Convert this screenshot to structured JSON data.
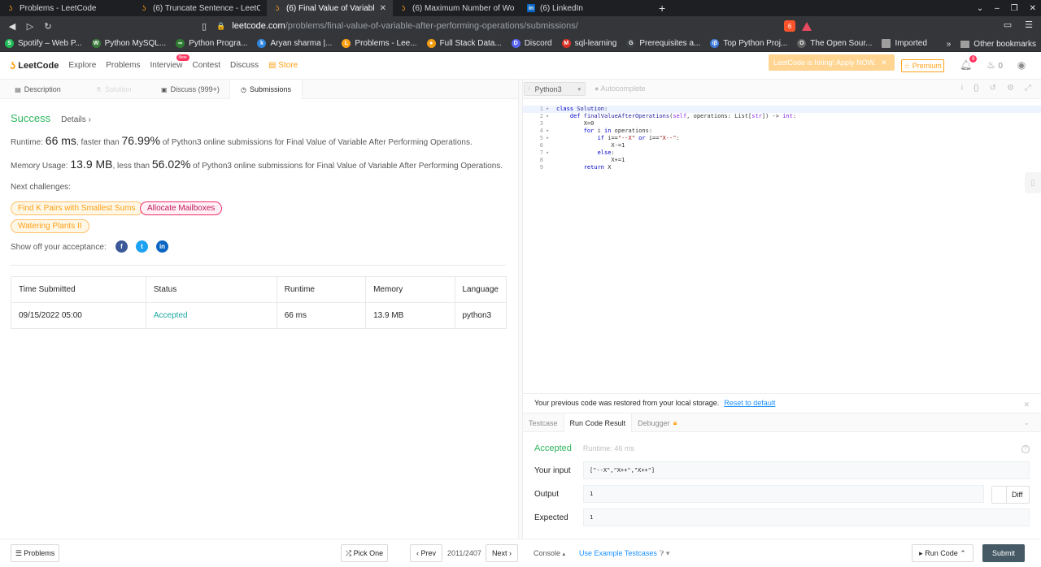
{
  "browser": {
    "tabs": [
      {
        "title": "Problems - LeetCode",
        "icon": "leetcode-icon"
      },
      {
        "title": "(6) Truncate Sentence - LeetCo",
        "icon": "leetcode-icon"
      },
      {
        "title": "(6) Final Value of Variable Af",
        "icon": "leetcode-icon"
      },
      {
        "title": "(6) Maximum Number of Words",
        "icon": "leetcode-icon"
      },
      {
        "title": "(6) LinkedIn",
        "icon": "linkedin-icon"
      }
    ],
    "url_host": "leetcode.com",
    "url_path": "/problems/final-value-of-variable-after-performing-operations/submissions/",
    "brave_badge": "6",
    "bookmarks": [
      {
        "label": "Spotify – Web P...",
        "color": "#1db954",
        "glyph": "S"
      },
      {
        "label": "Python MySQL...",
        "color": "#3a7a3a",
        "glyph": "W"
      },
      {
        "label": "Python Progra...",
        "color": "#2e7d32",
        "glyph": "∞"
      },
      {
        "label": "Aryan sharma |...",
        "color": "#2e86de",
        "glyph": "k"
      },
      {
        "label": "Problems - Lee...",
        "color": "#ffa116",
        "glyph": "L"
      },
      {
        "label": "Full Stack Data...",
        "color": "#f39c12",
        "glyph": "●"
      },
      {
        "label": "Discord",
        "color": "#5865f2",
        "glyph": "D"
      },
      {
        "label": "sql-learning",
        "color": "#d93025",
        "glyph": "M"
      },
      {
        "label": "Prerequisites a...",
        "color": "#3c4043",
        "glyph": "G"
      },
      {
        "label": "Top Python Proj...",
        "color": "#3c78d8",
        "glyph": "iβ"
      },
      {
        "label": "The Open Sour...",
        "color": "#616161",
        "glyph": "O"
      },
      {
        "label": "Imported",
        "color": "#9e9e9e",
        "glyph": "▬"
      }
    ],
    "bookmarks_more": "»",
    "other_bookmarks": "Other bookmarks"
  },
  "nav": {
    "logo": "LeetCode",
    "links": [
      "Explore",
      "Problems",
      "Interview",
      "Contest",
      "Discuss"
    ],
    "new_badge": "New",
    "store": "Store",
    "hiring_banner": "LeetCode is hiring! Apply NOW.",
    "premium": "Premium",
    "notification_count": "6",
    "streak_count": "0"
  },
  "left_tabs": [
    "Description",
    "Solution",
    "Discuss (999+)",
    "Submissions"
  ],
  "result": {
    "status": "Success",
    "details": "Details",
    "runtime_label": "Runtime:",
    "runtime_value": "66 ms",
    "runtime_mid": ", faster than",
    "runtime_pct": "76.99%",
    "runtime_tail": "of Python3 online submissions for Final Value of Variable After Performing Operations.",
    "memory_label": "Memory Usage:",
    "memory_value": "13.9 MB",
    "memory_mid": ", less than",
    "memory_pct": "56.02%",
    "memory_tail": "of Python3 online submissions for Final Value of Variable After Performing Operations.",
    "next_label": "Next challenges:",
    "challenges": [
      "Find K Pairs with Smallest Sums",
      "Allocate Mailboxes",
      "Watering Plants II"
    ],
    "share_label": "Show off your acceptance:"
  },
  "table": {
    "headers": [
      "Time Submitted",
      "Status",
      "Runtime",
      "Memory",
      "Language"
    ],
    "rows": [
      [
        "09/15/2022 05:00",
        "Accepted",
        "66 ms",
        "13.9 MB",
        "python3"
      ]
    ]
  },
  "editor": {
    "language": "Python3",
    "autocomplete": "Autocomplete",
    "line_numbers": [
      "1",
      "2",
      "3",
      "4",
      "5",
      "6",
      "7",
      "8",
      "9"
    ]
  },
  "console": {
    "restore_msg": "Your previous code was restored from your local storage.",
    "reset_link": "Reset to default",
    "tabs": [
      "Testcase",
      "Run Code Result",
      "Debugger"
    ],
    "status": "Accepted",
    "runtime": "Runtime: 46 ms",
    "input_label": "Your input",
    "input_value": "[\"--X\",\"X++\",\"X++\"]",
    "output_label": "Output",
    "output_value": "1",
    "expected_label": "Expected",
    "expected_value": "1",
    "diff_label": "Diff"
  },
  "bottom": {
    "problems": "Problems",
    "pick_one": "Pick One",
    "prev": "Prev",
    "page": "2011/2407",
    "next": "Next",
    "console": "Console",
    "use_example": "Use Example Testcases",
    "run_code": "Run Code",
    "submit": "Submit"
  }
}
